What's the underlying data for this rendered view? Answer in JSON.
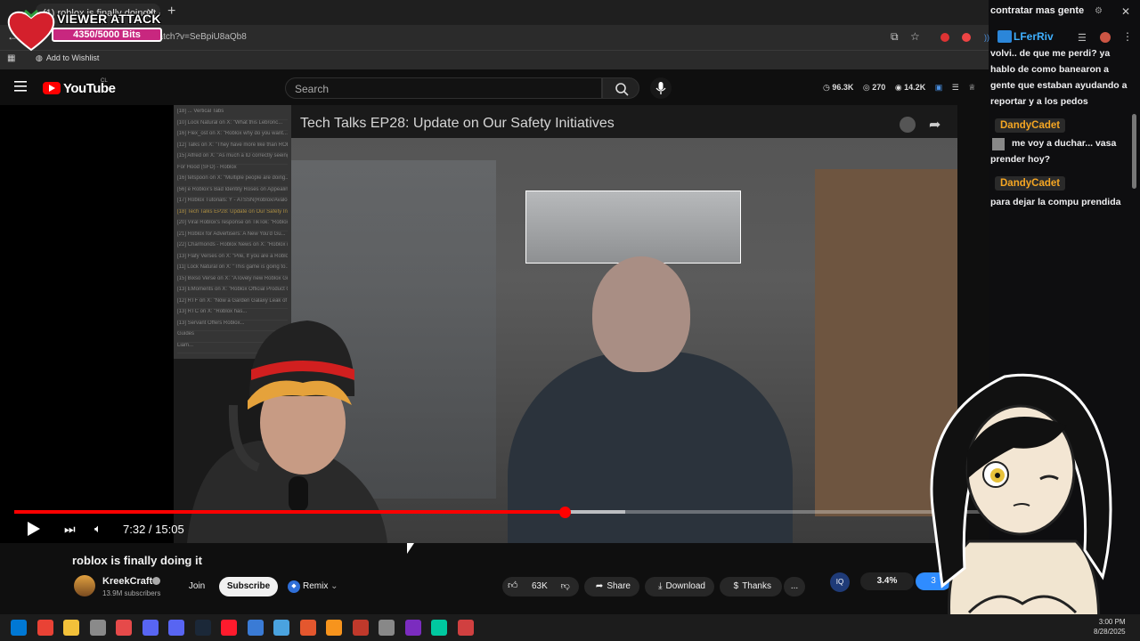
{
  "browser": {
    "tab_title": "(1) roblox is finally doing it - Yo",
    "url": "youtube.com/watch?v=SeBpiU8aQb8",
    "url_visible": "...watch?v=SeBpiU8aQb8",
    "bookmark_label": "Add to Wishlist"
  },
  "bits_overlay": {
    "title": "VIEWER ATTACK",
    "progress_text": "4350/5000 Bits",
    "progress": 0.87
  },
  "youtube": {
    "logo_text": "YouTube",
    "country": "CL",
    "search_placeholder": "Search",
    "stats": [
      "96.3K",
      "270",
      "14.2K"
    ]
  },
  "video": {
    "inner_title": "Tech Talks EP28: Update on Our Safety Initiatives",
    "time_display": "7:32 / 15:05",
    "progress": 0.4995,
    "side_rows": [
      "[18] ... Vertical Tabs",
      "[10] Lock Natural on X: \"What this Lebronc...",
      "[16] Flex_ost on X: \"Roblox why do you want...",
      "[12] Talks on X: \"They have more like than ROB...",
      "[15] Alfred on X: \"As much a ID correctly seeing...",
      "For Hood (SFD) - Roblox",
      "[16] tetspoon on X: \"Multiple people are doing...",
      "[56] e Roblox's Bad Identity Roses on Appealing...",
      "[17] Roblox Tutorials: Y - ATSSN(Roblox/Avalo...",
      "[18] Tech Talks EP28: Update on Our Safety Initiat...",
      "[20] Viral Roblox's response on TikTok: \"Roblox...",
      "[21] Roblox for Advertisers: A New You'd Gu...",
      "[22] Charmonds - Roblox News on X: \"Roblox is a...",
      "[13] Flafy Verses on X: \"Pile, If you are a Roblo...",
      "[11] Lock Natural on X: \"This game is going to...",
      "[15] Bixso Verse on X: \"A lovely new Roblox Gui...",
      "[13] EMoments on X: \"Roblox Official Product Gui...",
      "[12] RTF on X: \"Now a Garden Galaxy Leak of c...",
      "[13] RTC on X: \"Roblox has...",
      "[13] Servant Offers Roblox...",
      "Guides",
      "Liam..."
    ]
  },
  "below_video": {
    "title": "roblox is finally doing it",
    "channel_name": "KreekCraft",
    "subscribers": "13.9M subscribers",
    "join_label": "Join",
    "subscribe_label": "Subscribe",
    "remix_label": "Remix",
    "like_count": "63K",
    "share_label": "Share",
    "download_label": "Download",
    "thanks_label": "Thanks",
    "more_label": "...",
    "iq_label": "IQ",
    "percent_a": "3.4%",
    "percent_b": "3"
  },
  "chat": {
    "header": "contratar mas gente",
    "messages": [
      {
        "user": "LFerRiv",
        "text": "volvi.. de que me perdi? ya hablo de como banearon a gente que estaban ayudando a reportar y a los pedos"
      },
      {
        "user": "DandyCadet",
        "text": "me voy a duchar... vasa prender hoy?"
      },
      {
        "user": "DandyCadet",
        "text": "para dejar la compu prendida"
      }
    ]
  },
  "taskbar": {
    "time": "3:00 PM",
    "date": "8/28/2025",
    "apps": [
      "windows",
      "chrome",
      "explorer",
      "app3",
      "calendar",
      "discord",
      "discord2",
      "steam",
      "opera",
      "notepad",
      "notes",
      "app11",
      "app12",
      "app13",
      "app14",
      "app15",
      "audition",
      "app17"
    ]
  },
  "colors": {
    "youtube_red": "#ff0000",
    "bits_pink": "#c8277f",
    "chat_name_orange": "#f5a623",
    "chat_name_blue": "#3fb0ff"
  }
}
